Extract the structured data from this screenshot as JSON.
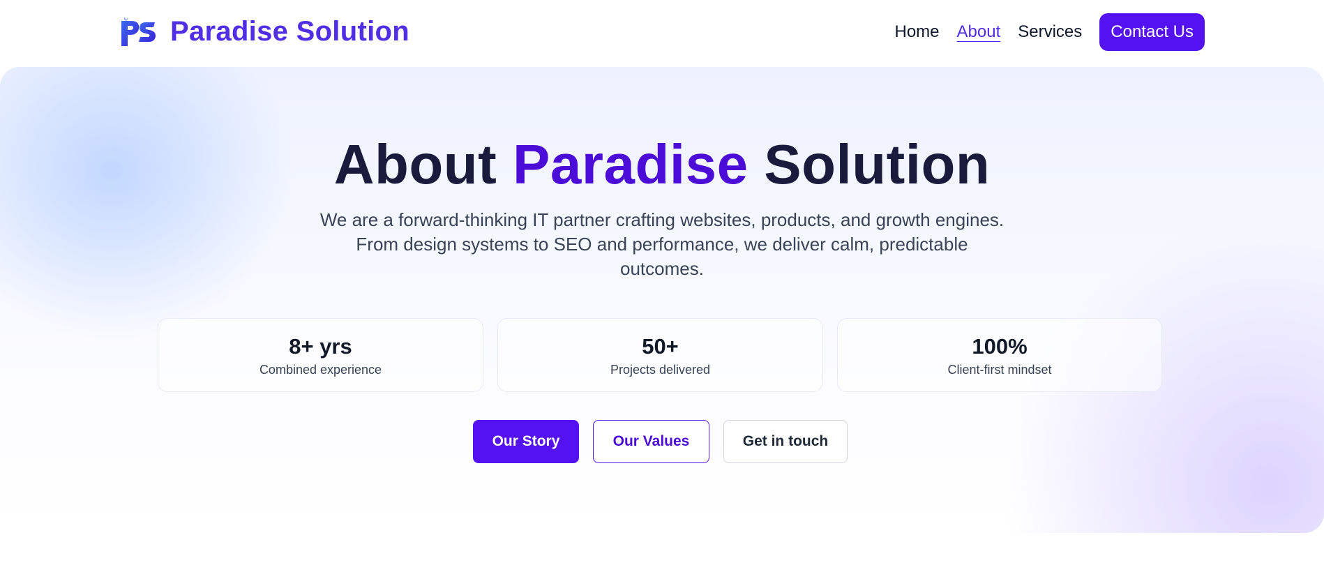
{
  "header": {
    "logo_icon": "ps-monogram-logo",
    "brand_name": "Paradise Solution",
    "nav": [
      {
        "label": "Home",
        "active": false
      },
      {
        "label": "About",
        "active": true
      },
      {
        "label": "Services",
        "active": false
      }
    ],
    "cta_label": "Contact Us"
  },
  "hero": {
    "title_part1": "About ",
    "title_accent": "Paradise",
    "title_part2": " Solution",
    "subtitle": "We are a forward-thinking IT partner crafting websites, products, and growth engines. From design systems to SEO and performance, we deliver calm, predictable outcomes.",
    "stats": [
      {
        "value": "8+ yrs",
        "label": "Combined experience"
      },
      {
        "value": "50+",
        "label": "Projects delivered"
      },
      {
        "value": "100%",
        "label": "Client-first mindset"
      }
    ],
    "buttons": {
      "primary": "Our Story",
      "outline": "Our Values",
      "ghost": "Get in touch"
    }
  },
  "colors": {
    "brand": "#4f2ee6",
    "accent": "#5412f0",
    "title_dark": "#1a1a3d"
  }
}
